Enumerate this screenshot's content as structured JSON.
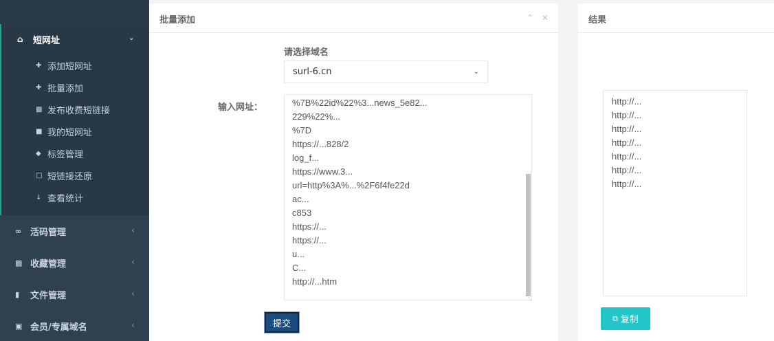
{
  "sidebar": {
    "active_group": {
      "label": "短网址",
      "icon": "home-icon"
    },
    "sub_items": [
      {
        "label": "添加短网址",
        "icon": "plus-icon"
      },
      {
        "label": "批量添加",
        "icon": "plus-icon"
      },
      {
        "label": "发布收费短链接",
        "icon": "money-icon"
      },
      {
        "label": "我的短网址",
        "icon": "folder-icon"
      },
      {
        "label": "标签管理",
        "icon": "tags-icon"
      },
      {
        "label": "短链接还原",
        "icon": "folder-open-icon"
      },
      {
        "label": "查看统计",
        "icon": "thermometer-icon"
      }
    ],
    "groups": [
      {
        "label": "活码管理",
        "icon": "bicycle-icon"
      },
      {
        "label": "收藏管理",
        "icon": "yandex-icon"
      },
      {
        "label": "文件管理",
        "icon": "file-icon"
      },
      {
        "label": "会员/专属域名",
        "icon": "cart-icon"
      }
    ]
  },
  "batch_panel": {
    "title": "批量添加",
    "domain_label": "请选择域名",
    "domain_selected": "surl-6.cn",
    "url_label": "输入网址：",
    "url_text": "%7B%22id%22%3...news_5e82...\n229%22%...\n%7D\nhttps://...828/2\nlog_f...\nhttps://www.3...\nurl=http%3A%...%2F6f4fe22d\nac...\nc853\nhttps://...\nhttps://...\nu...\nC...\nhttp://...htm",
    "submit_label": "提交"
  },
  "result_panel": {
    "title": "结果",
    "results": [
      "http://...",
      "http://...",
      "http://...",
      "http://...",
      "http://...",
      "http://...",
      "http://..."
    ],
    "copy_label": "复制"
  }
}
